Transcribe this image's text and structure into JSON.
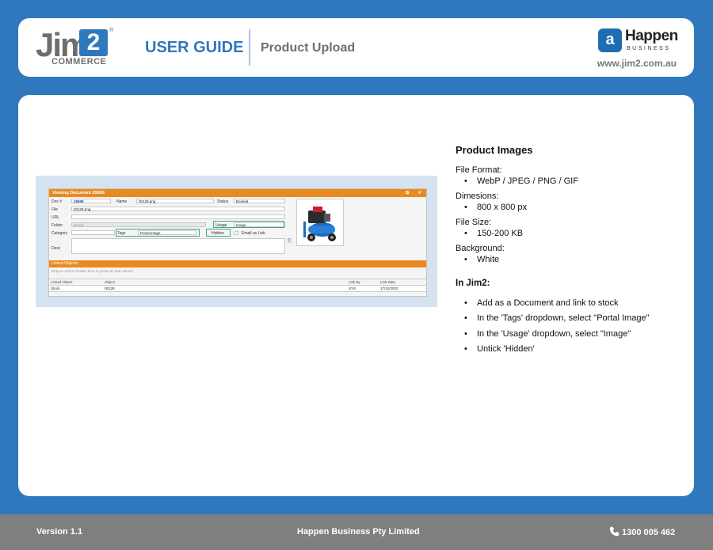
{
  "header": {
    "logo_text": "Jim",
    "logo_number": "2",
    "logo_sub": "COMMERCE",
    "logo_reg": "®",
    "guide_label": "USER GUIDE",
    "title": "Product Upload",
    "brand_mark": "a",
    "brand_name": "Happen",
    "brand_sub": "BUSINESS",
    "website": "www.jim2.com.au",
    "accent_color": "#2f78be"
  },
  "screenshot": {
    "window_title": "Viewing Document 29658",
    "doc_label": "Doc #",
    "doc_value": "29658",
    "name_label": "Name",
    "name_value": "00128.png",
    "status_label": "Status",
    "status_value": "Booked",
    "file_label": "File",
    "file_value": "00128.png",
    "url_label": "URL",
    "folder_label": "Folder",
    "folder_value": "[Root]",
    "usage_label": "Usage",
    "usage_value": "Image",
    "category_label": "Category",
    "tags_label": "Tags",
    "tags_value": "Portal Image",
    "hidden_label": "Hidden",
    "email_link_label": "Email as Link",
    "desc_label": "Desc",
    "linked_bar": "Linked Objects",
    "drag_hint": "Drag a column header here to group by that column",
    "columns": [
      "Linked Object",
      "Object",
      "Link By",
      "Link Date"
    ],
    "rows": [
      [
        "Stock",
        "00128",
        "SYS",
        "17/12/2022"
      ]
    ],
    "title_color": "#e98a21",
    "highlight_color": "#38a98c"
  },
  "product_images": {
    "heading": "Product Images",
    "sections": [
      {
        "label": "File Format:",
        "items": [
          "WebP / JPEG / PNG / GIF"
        ]
      },
      {
        "label": "Dimesions:",
        "items": [
          "800 x 800 px"
        ]
      },
      {
        "label": "File Size:",
        "items": [
          "150-200 KB"
        ]
      },
      {
        "label": "Background:",
        "items": [
          "White"
        ]
      }
    ],
    "jim2_heading": "In Jim2:",
    "jim2_items": [
      "Add as a Document and link to stock",
      "In the 'Tags' dropdown, select \"Portal Image\"",
      "In the 'Usage' dropdown, select \"Image\"",
      "Untick 'Hidden'"
    ],
    "bullet": "•"
  },
  "footer": {
    "version": "Version 1.1",
    "company": "Happen Business Pty Limited",
    "phone": "1300 005 462"
  }
}
